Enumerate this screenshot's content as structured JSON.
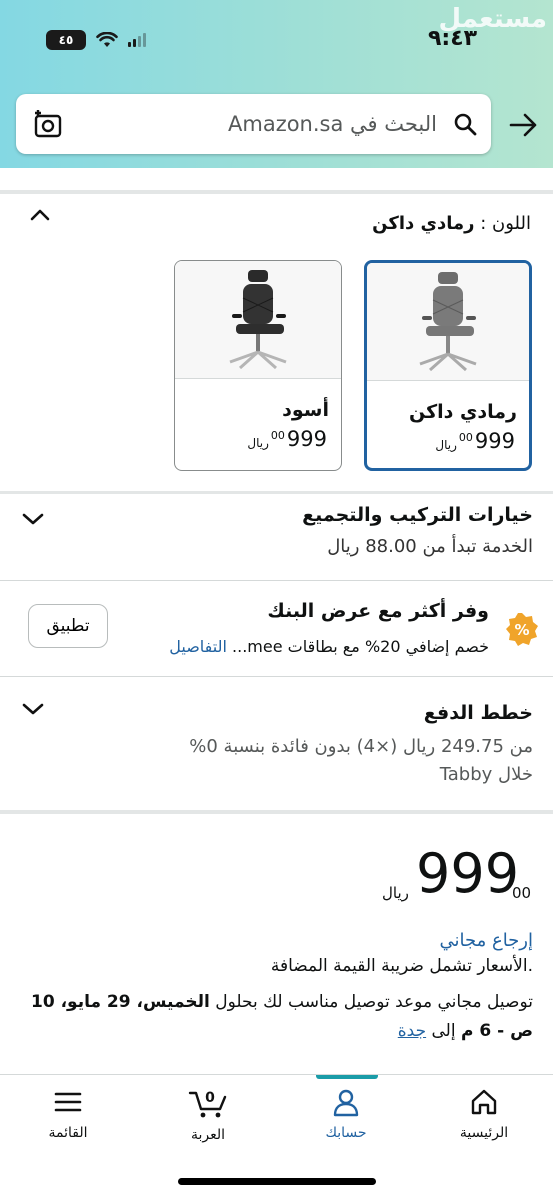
{
  "status_bar": {
    "time": "٩:٤٣",
    "battery": "٤٥",
    "watermark": "مستعمل"
  },
  "search": {
    "placeholder": "البحث في Amazon.sa"
  },
  "colors": {
    "accent": "#2162a1",
    "link": "#2162a1",
    "nav_active": "#1a9ca8",
    "deal": "#f0a42a"
  },
  "color_selector": {
    "label": "اللون :",
    "selected_value": "رمادي داكن",
    "options": [
      {
        "name": "رمادي داكن",
        "price_whole": "999",
        "price_fraction": "00",
        "currency": "ريال",
        "selected": true
      },
      {
        "name": "أسود",
        "price_whole": "999",
        "price_fraction": "00",
        "currency": "ريال",
        "selected": false
      }
    ]
  },
  "installation": {
    "title": "خيارات التركيب والتجميع",
    "subtitle": "الخدمة تبدأ من 88.00 ريال"
  },
  "bank_offer": {
    "title": "وفر أكثر مع عرض البنك",
    "description": "خصم إضافي 20% مع بطاقات mee...",
    "details_link": "التفاصيل",
    "apply_button": "تطبيق"
  },
  "payment_plans": {
    "title": "خطط الدفع",
    "line1": "من 249.75 ريال (×4) بدون فائدة بنسبة 0%",
    "line2": "خلال Tabby"
  },
  "price": {
    "whole": "999",
    "fraction": "00",
    "currency": "ريال"
  },
  "returns": "إرجاع مجاني",
  "vat_note": ".الأسعار تشمل ضريبة القيمة المضافة",
  "delivery": {
    "prefix": "توصيل مجاني موعد توصيل مناسب لك بحلول",
    "day": "الخميس، 29 مايو، 10 ص - 6 م",
    "to": "إلى",
    "city": "جدة"
  },
  "bottom_nav": {
    "home": "الرئيسية",
    "account": "حسابك",
    "cart": "العربة",
    "cart_count": "0",
    "menu": "القائمة"
  }
}
